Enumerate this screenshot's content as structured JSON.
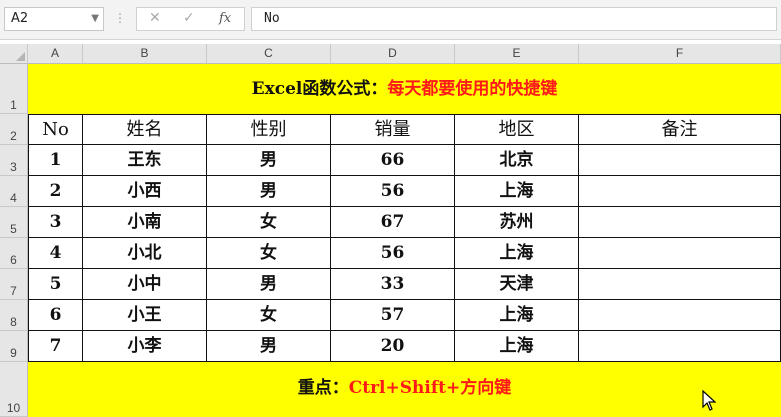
{
  "formula_bar": {
    "name_box": "A2",
    "cancel_icon": "✕",
    "confirm_icon": "✓",
    "fx_label": "fx",
    "formula_value": "No"
  },
  "columns": [
    "A",
    "B",
    "C",
    "D",
    "E",
    "F"
  ],
  "rows": [
    "1",
    "2",
    "3",
    "4",
    "5",
    "6",
    "7",
    "8",
    "9",
    "10"
  ],
  "sheet": {
    "title_prefix": "Excel函数公式：",
    "title_highlight": "每天都要使用的快捷键",
    "headers": [
      "No",
      "姓名",
      "性别",
      "销量",
      "地区",
      "备注"
    ],
    "data": [
      [
        "1",
        "王东",
        "男",
        "66",
        "北京",
        ""
      ],
      [
        "2",
        "小西",
        "男",
        "56",
        "上海",
        ""
      ],
      [
        "3",
        "小南",
        "女",
        "67",
        "苏州",
        ""
      ],
      [
        "4",
        "小北",
        "女",
        "56",
        "上海",
        ""
      ],
      [
        "5",
        "小中",
        "男",
        "33",
        "天津",
        ""
      ],
      [
        "6",
        "小王",
        "女",
        "57",
        "上海",
        ""
      ],
      [
        "7",
        "小李",
        "男",
        "20",
        "上海",
        ""
      ]
    ],
    "footer_prefix": "重点：",
    "footer_highlight": "Ctrl+Shift+方向键"
  },
  "colors": {
    "highlight_fill": "#ffff00",
    "accent_text": "#ff1a1a"
  }
}
